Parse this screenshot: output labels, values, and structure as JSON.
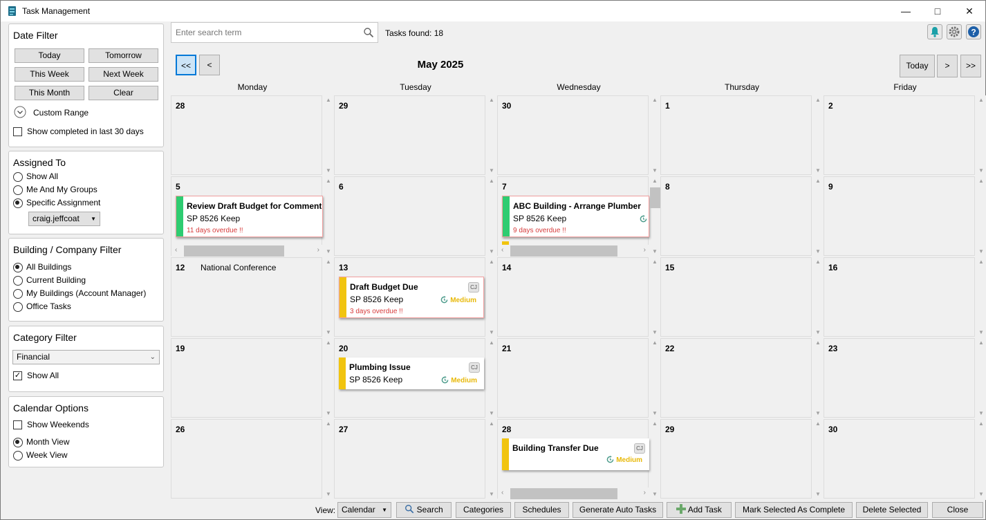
{
  "window": {
    "title": "Task Management"
  },
  "search": {
    "placeholder": "Enter search term"
  },
  "tasks_found": "Tasks found: 18",
  "date_filter": {
    "title": "Date Filter",
    "buttons": [
      "Today",
      "Tomorrow",
      "This Week",
      "Next Week",
      "This Month",
      "Clear"
    ],
    "custom_range": "Custom Range",
    "show_completed": "Show completed in last 30 days",
    "show_completed_checked": false
  },
  "assigned_to": {
    "title": "Assigned To",
    "options": [
      "Show All",
      "Me And My Groups",
      "Specific Assignment"
    ],
    "selected": "Specific Assignment",
    "user": "craig.jeffcoat"
  },
  "building_filter": {
    "title": "Building / Company Filter",
    "options": [
      "All Buildings",
      "Current Building",
      "My Buildings (Account Manager)",
      "Office Tasks"
    ],
    "selected": "All Buildings"
  },
  "category_filter": {
    "title": "Category Filter",
    "selected": "Financial",
    "show_all": "Show All",
    "show_all_checked": true
  },
  "calendar_options": {
    "title": "Calendar Options",
    "show_weekends": "Show Weekends",
    "show_weekends_checked": false,
    "views": [
      "Month View",
      "Week View"
    ],
    "selected_view": "Month View"
  },
  "calendar": {
    "nav": {
      "prev_prev": "<<",
      "prev": "<",
      "today": "Today",
      "next": ">",
      "next_next": ">>"
    },
    "month_title": "May 2025",
    "day_names": [
      "Monday",
      "Tuesday",
      "Wednesday",
      "Thursday",
      "Friday"
    ],
    "weeks": [
      [
        "28",
        "29",
        "30",
        "1",
        "2"
      ],
      [
        "5",
        "6",
        "7",
        "8",
        "9"
      ],
      [
        "12",
        "13",
        "14",
        "15",
        "16"
      ],
      [
        "19",
        "20",
        "21",
        "22",
        "23"
      ],
      [
        "26",
        "27",
        "28",
        "29",
        "30"
      ]
    ],
    "events": {
      "w2d0": "National Conference"
    },
    "tasks": {
      "w1d0": {
        "title": "Review Draft Budget for Comment",
        "building": "SP 8526 Keep",
        "overdue": "11 days overdue !!",
        "color": "#2ecc71"
      },
      "w1d2": {
        "title": "ABC Building - Arrange Plumber",
        "building": "SP 8526 Keep",
        "overdue": "9 days overdue !!",
        "color": "#2ecc71"
      },
      "w2d1": {
        "title": "Draft Budget Due",
        "building": "SP 8526 Keep",
        "overdue": "3 days overdue !!",
        "priority": "Medium",
        "initials": "CJ",
        "color": "#f1c40f"
      },
      "w3d1": {
        "title": "Plumbing Issue",
        "building": "SP 8526 Keep",
        "priority": "Medium",
        "initials": "CJ",
        "color": "#f1c40f"
      },
      "w4d2": {
        "title": "Building Transfer Due",
        "priority": "Medium",
        "initials": "CJ",
        "color": "#f1c40f"
      }
    }
  },
  "bottom": {
    "view_label": "View:",
    "view_value": "Calendar",
    "search": "Search",
    "categories": "Categories",
    "schedules": "Schedules",
    "generate": "Generate Auto Tasks",
    "add_task": "Add Task",
    "mark_complete": "Mark Selected As Complete",
    "delete": "Delete Selected",
    "close": "Close"
  }
}
